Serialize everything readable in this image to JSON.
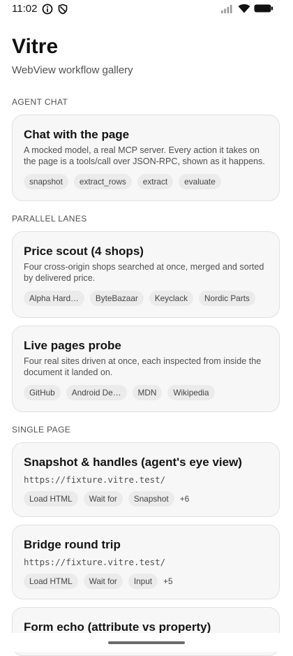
{
  "status_bar": {
    "time": "11:02"
  },
  "header": {
    "title": "Vitre",
    "subtitle": "WebView workflow gallery"
  },
  "sections": [
    {
      "header": "AGENT CHAT",
      "cards": [
        {
          "title": "Chat with the page",
          "description": "A mocked model, a real MCP server. Every action it takes on the page is a tools/call over JSON-RPC, shown as it happens.",
          "chips": [
            "snapshot",
            "extract_rows",
            "extract",
            "evaluate"
          ]
        }
      ]
    },
    {
      "header": "PARALLEL LANES",
      "cards": [
        {
          "title": "Price scout (4 shops)",
          "description": "Four cross-origin shops searched at once, merged and sorted by delivered price.",
          "chips": [
            "Alpha Hard…",
            "ByteBazaar",
            "Keyclack",
            "Nordic Parts"
          ]
        },
        {
          "title": "Live pages probe",
          "description": "Four real sites driven at once, each inspected from inside the document it landed on.",
          "chips": [
            "GitHub",
            "Android De…",
            "MDN",
            "Wikipedia"
          ]
        }
      ]
    },
    {
      "header": "SINGLE PAGE",
      "cards": [
        {
          "title": "Snapshot & handles (agent's eye view)",
          "url": "https://fixture.vitre.test/",
          "chips": [
            "Load HTML",
            "Wait for",
            "Snapshot"
          ],
          "more": "+6"
        },
        {
          "title": "Bridge round trip",
          "url": "https://fixture.vitre.test/",
          "chips": [
            "Load HTML",
            "Wait for",
            "Input"
          ],
          "more": "+5"
        },
        {
          "title": "Form echo (attribute vs property)"
        }
      ]
    }
  ]
}
